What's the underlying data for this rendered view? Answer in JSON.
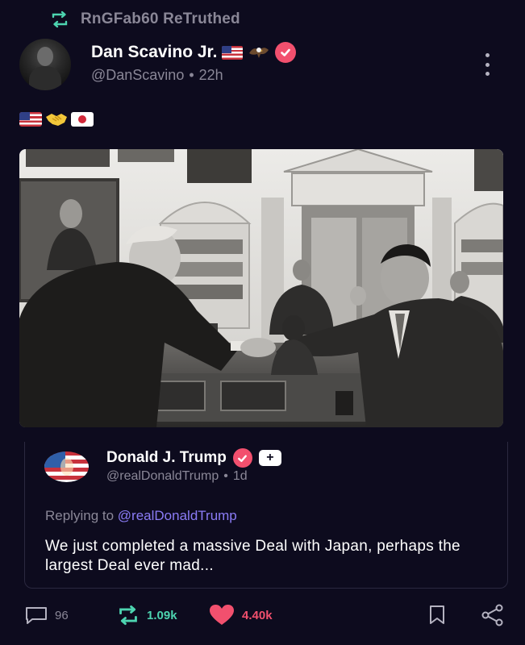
{
  "retruth": {
    "label": "RnGFab60 ReTruthed",
    "icon": "retruth-icon"
  },
  "post": {
    "author_name": "Dan Scavino Jr.",
    "author_handle": "@DanScavino",
    "separator": "•",
    "time": "22h",
    "name_emoji": [
      "us-flag-emoji",
      "eagle-emoji"
    ],
    "verified_icon": "verified-badge-icon",
    "more_icon": "more-vertical-icon",
    "body_emojis": [
      "us-flag-emoji",
      "handshake-emoji",
      "japan-flag-emoji"
    ]
  },
  "quote": {
    "author_name": "Donald J. Trump",
    "author_handle": "@realDonaldTrump",
    "separator": "•",
    "time": "1d",
    "plus_badge": "+",
    "replying_prefix": "Replying to",
    "replying_handle": "@realDonaldTrump",
    "body": "We just completed a massive Deal with Japan, perhaps the largest Deal ever mad..."
  },
  "actions": {
    "replies": "96",
    "retruths": "1.09k",
    "likes": "4.40k"
  },
  "colors": {
    "background": "#0d0b1e",
    "muted_text": "#8a8797",
    "verified": "#f2506e",
    "retruth": "#4dd4b0",
    "like": "#f2506e",
    "mention": "#8b7cf6"
  }
}
